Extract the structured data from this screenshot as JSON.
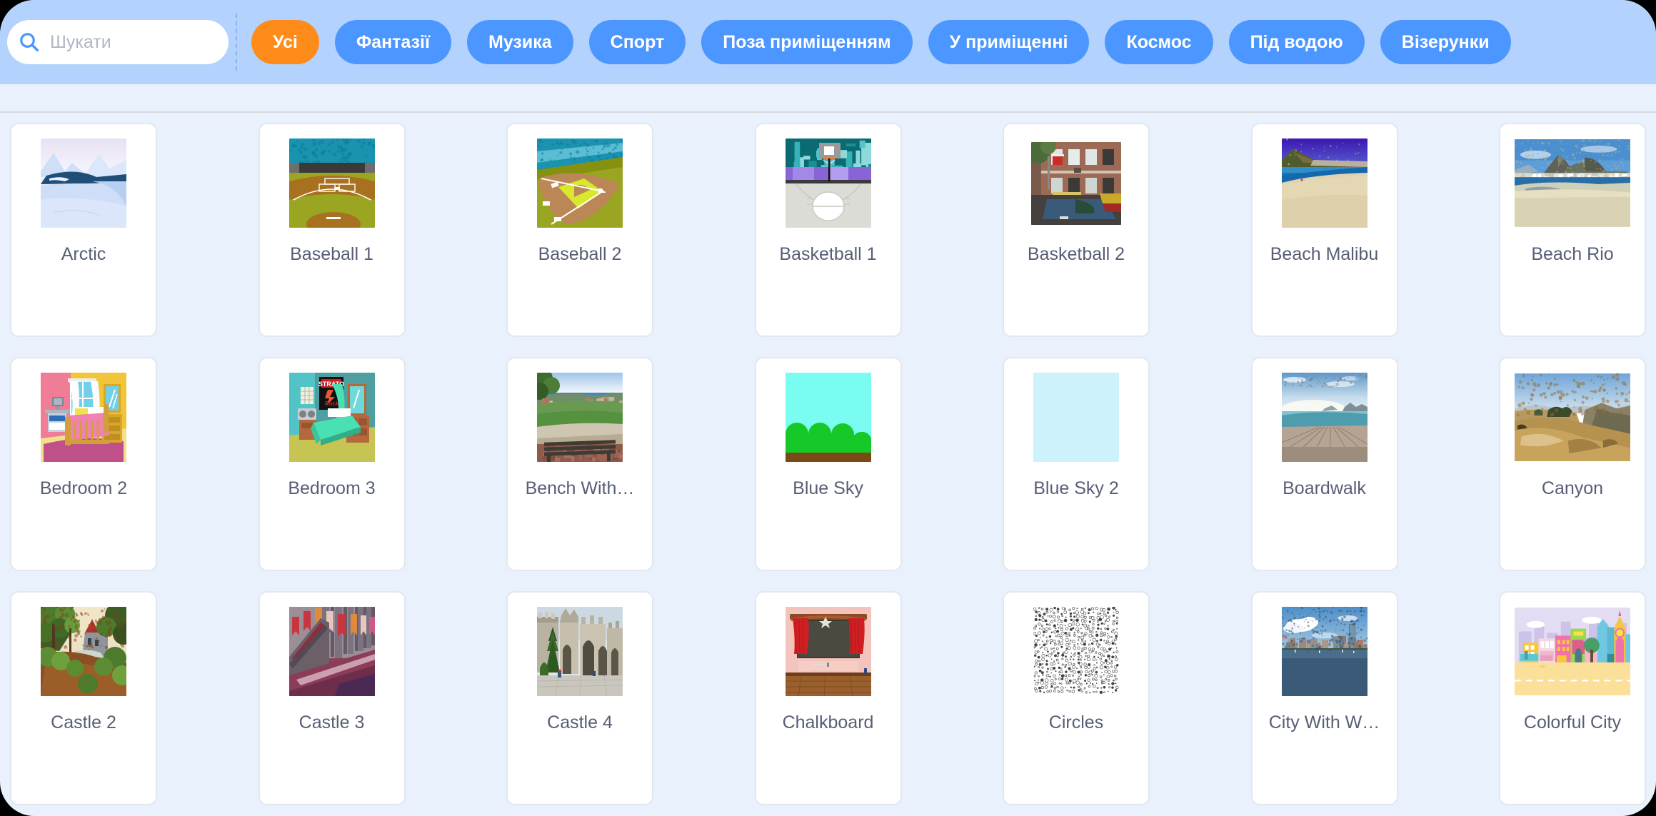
{
  "header": {
    "search": {
      "placeholder": "Шукати",
      "value": "",
      "icon": "search-icon"
    },
    "tags": [
      {
        "label": "Усі",
        "active": true
      },
      {
        "label": "Фантазії",
        "active": false
      },
      {
        "label": "Музика",
        "active": false
      },
      {
        "label": "Спорт",
        "active": false
      },
      {
        "label": "Поза приміщенням",
        "active": false
      },
      {
        "label": "У приміщенні",
        "active": false
      },
      {
        "label": "Космос",
        "active": false
      },
      {
        "label": "Під водою",
        "active": false
      },
      {
        "label": "Візерунки",
        "active": false
      }
    ]
  },
  "colors": {
    "header_bg": "#b3d2fd",
    "page_bg": "#e9f1fc",
    "tag_bg": "#4c97ff",
    "tag_active_bg": "#ff8c1a",
    "card_bg": "#ffffff",
    "card_border": "#e3e6ef",
    "label_text": "#575e75",
    "placeholder_text": "#b0b6c5"
  },
  "grid": {
    "columns": 7,
    "items": [
      {
        "label": "Arctic",
        "thumb": "arctic"
      },
      {
        "label": "Baseball 1",
        "thumb": "baseball1"
      },
      {
        "label": "Baseball 2",
        "thumb": "baseball2"
      },
      {
        "label": "Basketball 1",
        "thumb": "basketball1"
      },
      {
        "label": "Basketball 2",
        "thumb": "basketball2"
      },
      {
        "label": "Beach Malibu",
        "thumb": "beachmalibu"
      },
      {
        "label": "Beach Rio",
        "thumb": "beachrio"
      },
      {
        "label": "Bedroom 2",
        "thumb": "bedroom2"
      },
      {
        "label": "Bedroom 3",
        "thumb": "bedroom3"
      },
      {
        "label": "Bench With…",
        "thumb": "bench"
      },
      {
        "label": "Blue Sky",
        "thumb": "bluesky"
      },
      {
        "label": "Blue Sky 2",
        "thumb": "bluesky2"
      },
      {
        "label": "Boardwalk",
        "thumb": "boardwalk"
      },
      {
        "label": "Canyon",
        "thumb": "canyon"
      },
      {
        "label": "Castle 2",
        "thumb": "castle2"
      },
      {
        "label": "Castle 3",
        "thumb": "castle3"
      },
      {
        "label": "Castle 4",
        "thumb": "castle4"
      },
      {
        "label": "Chalkboard",
        "thumb": "chalkboard"
      },
      {
        "label": "Circles",
        "thumb": "circles"
      },
      {
        "label": "City With W…",
        "thumb": "citywater"
      },
      {
        "label": "Colorful City",
        "thumb": "colorfulcity"
      }
    ]
  }
}
